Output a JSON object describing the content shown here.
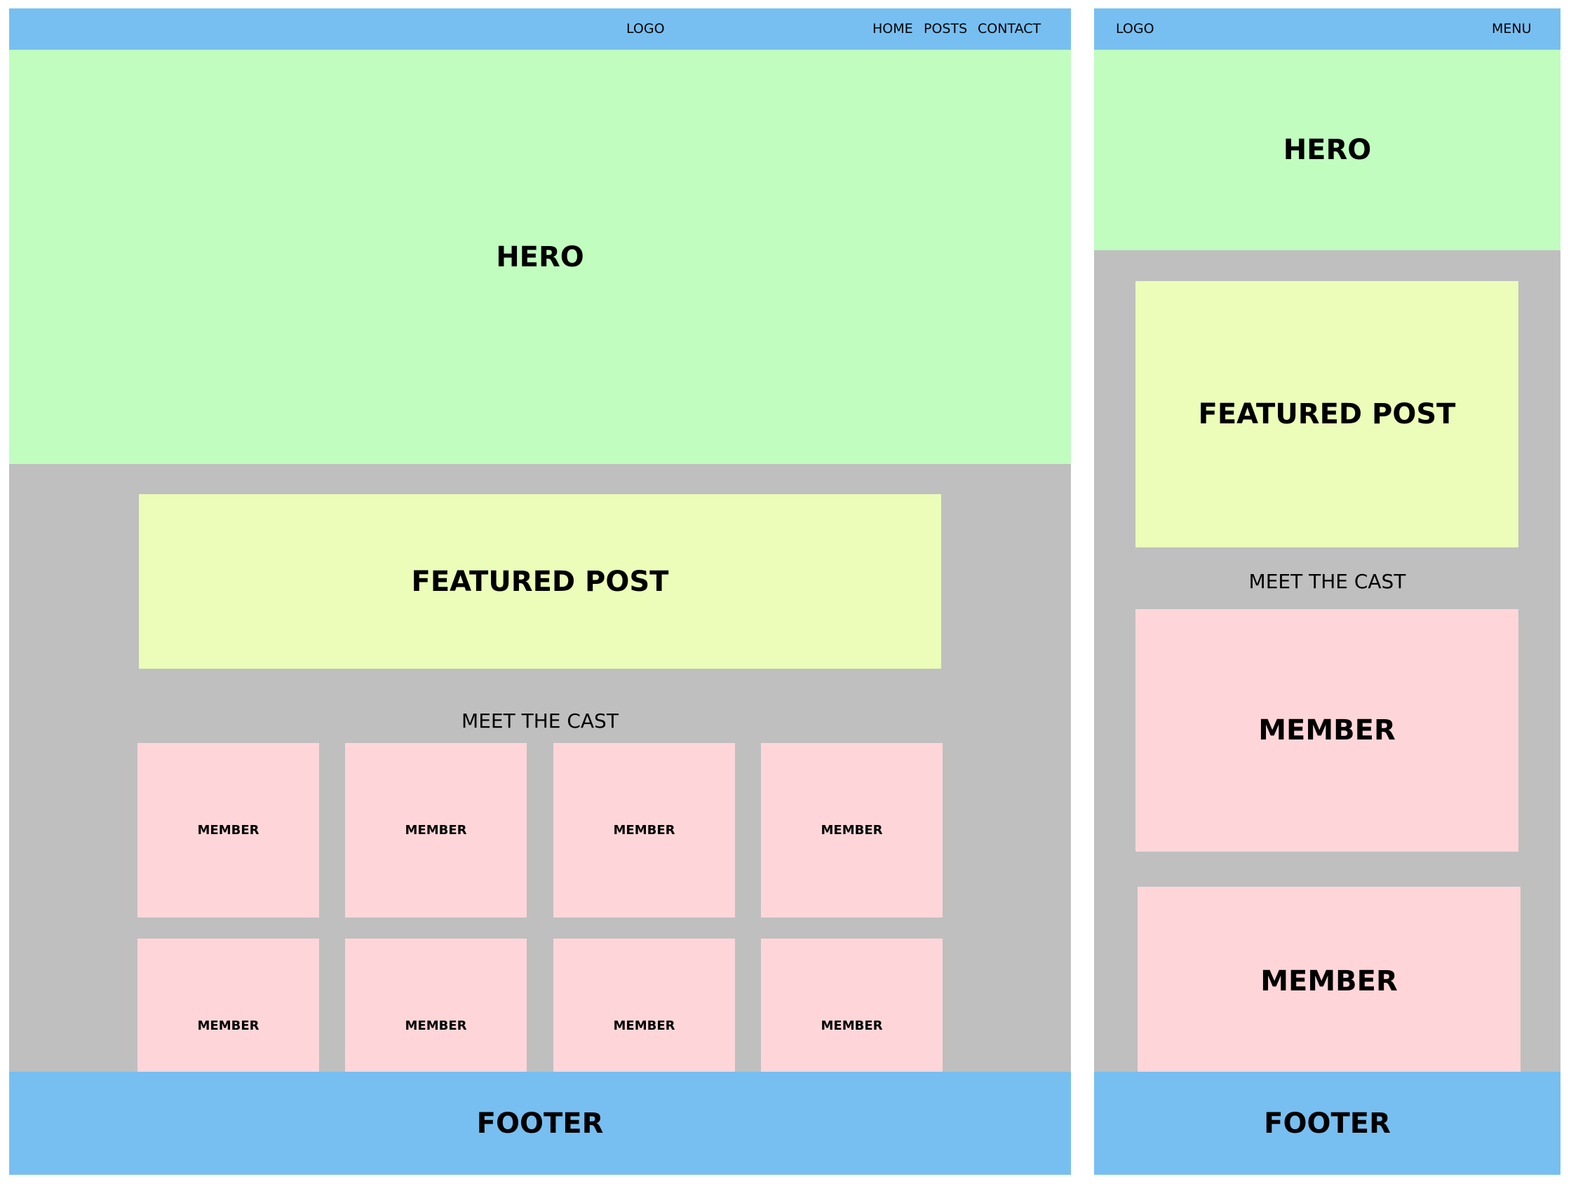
{
  "desktop": {
    "header": {
      "logo": "LOGO",
      "nav": [
        {
          "label": "HOME"
        },
        {
          "label": "POSTS"
        },
        {
          "label": "CONTACT"
        }
      ]
    },
    "hero": {
      "label": "HERO"
    },
    "featured": {
      "label": "FEATURED POST"
    },
    "cast": {
      "title": "MEET THE CAST",
      "members": [
        {
          "label": "MEMBER"
        },
        {
          "label": "MEMBER"
        },
        {
          "label": "MEMBER"
        },
        {
          "label": "MEMBER"
        },
        {
          "label": "MEMBER"
        },
        {
          "label": "MEMBER"
        },
        {
          "label": "MEMBER"
        },
        {
          "label": "MEMBER"
        }
      ]
    },
    "footer": {
      "label": "FOOTER"
    }
  },
  "mobile": {
    "header": {
      "logo": "LOGO",
      "menu": "MENU"
    },
    "hero": {
      "label": "HERO"
    },
    "featured": {
      "label": "FEATURED POST"
    },
    "cast": {
      "title": "MEET THE CAST",
      "members": [
        {
          "label": "MEMBER"
        },
        {
          "label": "MEMBER"
        }
      ]
    },
    "footer": {
      "label": "FOOTER"
    }
  },
  "colors": {
    "header": "#77bff1",
    "hero": "#c0fdbf",
    "main": "#bfbfbf",
    "featured": "#ebfdb8",
    "member": "#fed6d9",
    "footer": "#77bff1"
  }
}
